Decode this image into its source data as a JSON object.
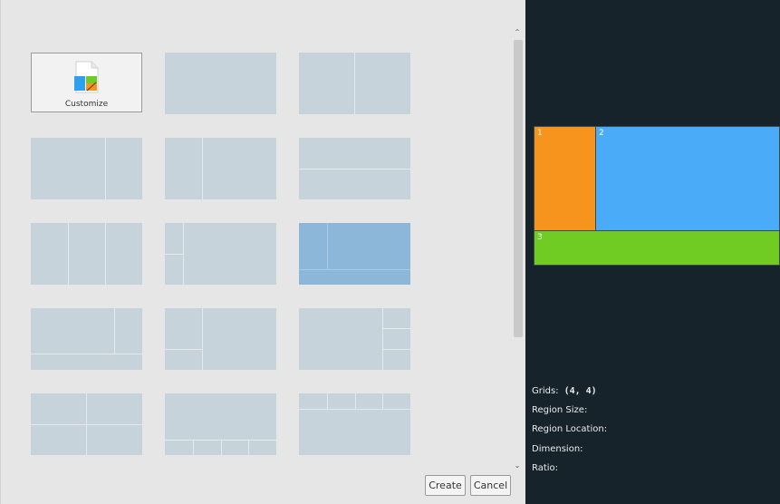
{
  "templates": {
    "customize_label": "Customize",
    "selected_index": 8
  },
  "actions": {
    "create_label": "Create",
    "cancel_label": "Cancel"
  },
  "preview": {
    "regions": [
      {
        "label": "1",
        "color": "#f7941d"
      },
      {
        "label": "2",
        "color": "#4aabf8"
      },
      {
        "label": "3",
        "color": "#70cc23"
      }
    ]
  },
  "info": {
    "grids_label": "Grids:",
    "grids_value": "(4, 4)",
    "region_size_label": "Region Size:",
    "region_location_label": "Region Location:",
    "dimension_label": "Dimension:",
    "ratio_label": "Ratio:"
  },
  "icons": {
    "customize": "customize-layout-icon",
    "scroll_up": "chevron-up-icon",
    "scroll_down": "chevron-down-icon"
  }
}
